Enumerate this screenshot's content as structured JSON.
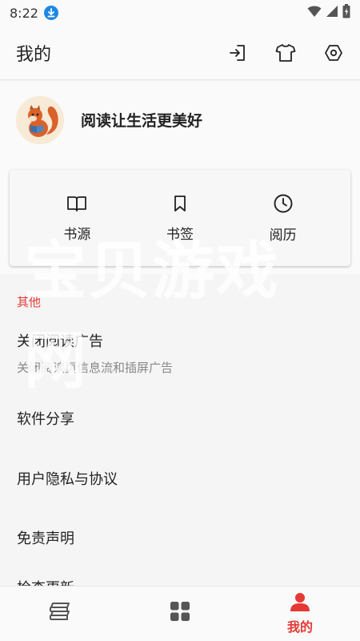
{
  "status_bar": {
    "time": "8:22"
  },
  "header": {
    "title": "我的"
  },
  "profile": {
    "name": "阅读让生活更美好"
  },
  "quick_actions": [
    {
      "label": "书源",
      "icon": "book-open-icon"
    },
    {
      "label": "书签",
      "icon": "bookmark-icon"
    },
    {
      "label": "阅历",
      "icon": "clock-icon"
    }
  ],
  "settings": {
    "section_title": "其他",
    "items": [
      {
        "title": "关闭阅读广告",
        "subtitle": "关闭阅读页信息流和插屏广告"
      },
      {
        "title": "软件分享"
      },
      {
        "title": "用户隐私与协议"
      },
      {
        "title": "免责声明"
      },
      {
        "title": "检查更新"
      }
    ]
  },
  "watermark": "宝贝游戏网",
  "bottom_nav": {
    "items": [
      {
        "label": "",
        "icon": "bookshelf-icon"
      },
      {
        "label": "",
        "icon": "discover-grid-icon"
      },
      {
        "label": "我的",
        "icon": "person-icon"
      }
    ]
  },
  "colors": {
    "accent": "#e53935",
    "download_badge": "#1e88e5"
  }
}
